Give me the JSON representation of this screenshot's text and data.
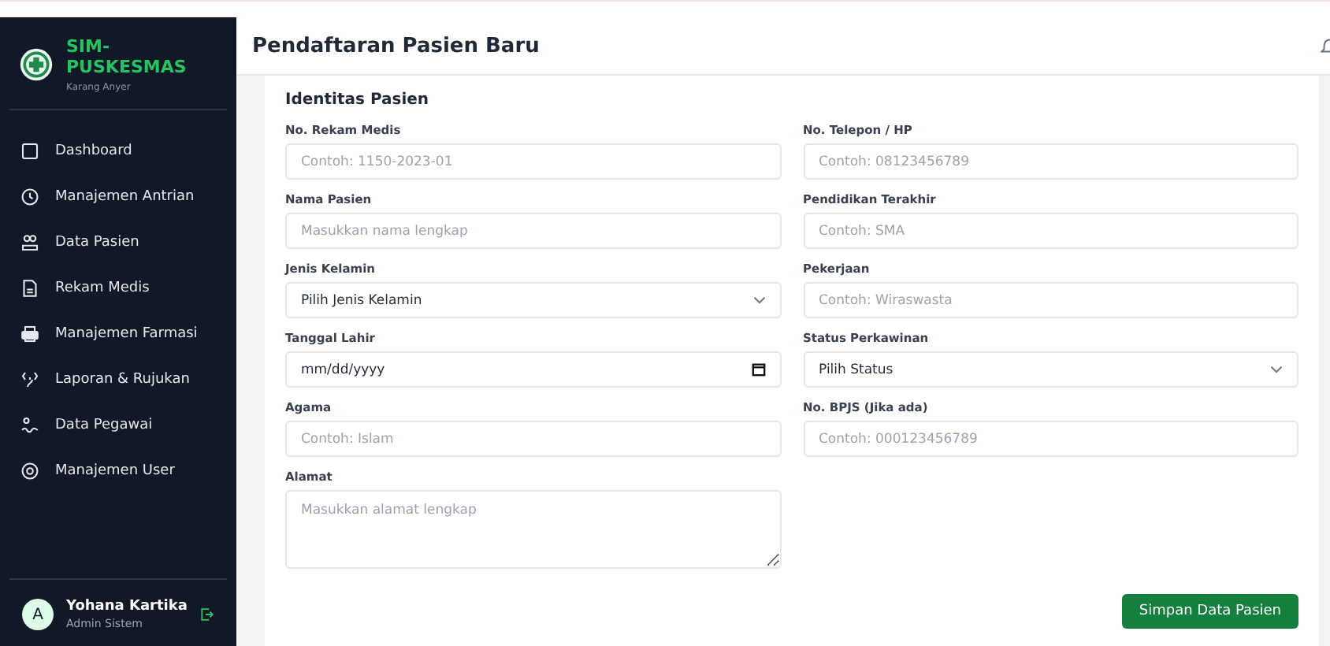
{
  "sidebar": {
    "brand": {
      "title": "SIM-\nPUSKESMAS",
      "subtitle": "Karang Anyer"
    },
    "items": [
      {
        "label": "Dashboard"
      },
      {
        "label": "Manajemen Antrian"
      },
      {
        "label": "Data Pasien"
      },
      {
        "label": "Rekam Medis"
      },
      {
        "label": "Manajemen Farmasi"
      },
      {
        "label": "Laporan & Rujukan"
      },
      {
        "label": "Data Pegawai"
      },
      {
        "label": "Manajemen User"
      }
    ],
    "user": {
      "initial": "A",
      "name": "Yohana Kartika",
      "role": "Admin Sistem"
    }
  },
  "header": {
    "title": "Pendaftaran Pasien Baru"
  },
  "form": {
    "section": "Identitas Pasien",
    "left": [
      {
        "kind": "text",
        "label": "No. Rekam Medis",
        "placeholder": "Contoh: 1150-2023-01"
      },
      {
        "kind": "text",
        "label": "Nama Pasien",
        "placeholder": "Masukkan nama lengkap"
      },
      {
        "kind": "select",
        "label": "Jenis Kelamin",
        "value": "Pilih Jenis Kelamin"
      },
      {
        "kind": "date",
        "label": "Tanggal Lahir",
        "value": "mm/dd/yyyy"
      },
      {
        "kind": "text",
        "label": "Agama",
        "placeholder": "Contoh: Islam"
      },
      {
        "kind": "textarea",
        "label": "Alamat",
        "placeholder": "Masukkan alamat lengkap"
      }
    ],
    "right": [
      {
        "kind": "text",
        "label": "No. Telepon / HP",
        "placeholder": "Contoh: 08123456789"
      },
      {
        "kind": "text",
        "label": "Pendidikan Terakhir",
        "placeholder": "Contoh: SMA"
      },
      {
        "kind": "text",
        "label": "Pekerjaan",
        "placeholder": "Contoh: Wiraswasta"
      },
      {
        "kind": "select",
        "label": "Status Perkawinan",
        "value": "Pilih Status"
      },
      {
        "kind": "text",
        "label": "No. BPJS (Jika ada)",
        "placeholder": "Contoh: 000123456789"
      }
    ],
    "submit": "Simpan Data Pasien"
  }
}
